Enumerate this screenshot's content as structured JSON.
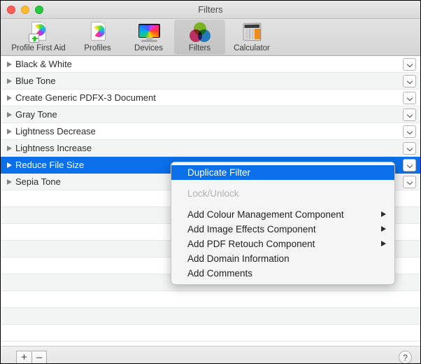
{
  "window": {
    "title": "Filters",
    "traffic_lights": [
      "close",
      "minimize",
      "maximize"
    ]
  },
  "toolbar": {
    "items": [
      {
        "id": "profile-first-aid",
        "label": "Profile First Aid",
        "icon": "profile-first-aid-icon",
        "selected": false
      },
      {
        "id": "profiles",
        "label": "Profiles",
        "icon": "profiles-icon",
        "selected": false
      },
      {
        "id": "devices",
        "label": "Devices",
        "icon": "devices-icon",
        "selected": false
      },
      {
        "id": "filters",
        "label": "Filters",
        "icon": "filters-icon",
        "selected": true
      },
      {
        "id": "calculator",
        "label": "Calculator",
        "icon": "calculator-icon",
        "selected": false
      }
    ]
  },
  "filter_list": {
    "rows": [
      {
        "label": "Black & White",
        "selected": false,
        "has_popup": true
      },
      {
        "label": "Blue Tone",
        "selected": false,
        "has_popup": true
      },
      {
        "label": "Create Generic PDFX-3 Document",
        "selected": false,
        "has_popup": true
      },
      {
        "label": "Gray Tone",
        "selected": false,
        "has_popup": true
      },
      {
        "label": "Lightness Decrease",
        "selected": false,
        "has_popup": true
      },
      {
        "label": "Lightness Increase",
        "selected": false,
        "has_popup": true
      },
      {
        "label": "Reduce File Size",
        "selected": true,
        "has_popup": true
      },
      {
        "label": "Sepia Tone",
        "selected": false,
        "has_popup": true
      }
    ],
    "empty_row_count": 9,
    "selection_color": "#0a6fe8",
    "stripe_color": "#f3f4f4"
  },
  "context_menu": {
    "items": [
      {
        "label": "Duplicate Filter",
        "state": "highlighted",
        "submenu": false
      },
      {
        "label": "Lock/Unlock",
        "state": "disabled",
        "submenu": false
      },
      {
        "label": "Add Colour Management Component",
        "state": "normal",
        "submenu": true
      },
      {
        "label": "Add Image Effects Component",
        "state": "normal",
        "submenu": true
      },
      {
        "label": "Add PDF Retouch Component",
        "state": "normal",
        "submenu": true
      },
      {
        "label": "Add Domain Information",
        "state": "normal",
        "submenu": false
      },
      {
        "label": "Add Comments",
        "state": "normal",
        "submenu": false
      }
    ]
  },
  "bottom_bar": {
    "add_label": "+",
    "remove_label": "–",
    "help_label": "?"
  }
}
